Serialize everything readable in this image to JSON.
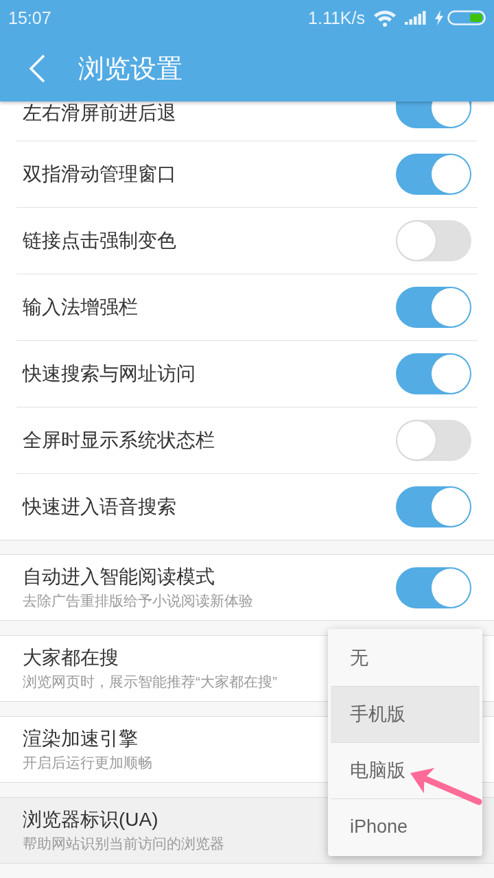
{
  "status_bar": {
    "time": "15:07",
    "net_speed": "1.11K/s"
  },
  "app_bar": {
    "title": "浏览设置"
  },
  "toggle_group": [
    {
      "label": "左右滑屏前进后退",
      "on": true
    },
    {
      "label": "双指滑动管理窗口",
      "on": true
    },
    {
      "label": "链接点击强制变色",
      "on": false
    },
    {
      "label": "输入法增强栏",
      "on": true
    },
    {
      "label": "快速搜索与网址访问",
      "on": true
    },
    {
      "label": "全屏时显示系统状态栏",
      "on": false
    },
    {
      "label": "快速进入语音搜索",
      "on": true
    }
  ],
  "cards": [
    {
      "kind": "toggle",
      "title": "自动进入智能阅读模式",
      "subtitle": "去除广告重排版给予小说阅读新体验",
      "on": true,
      "pressed": false
    },
    {
      "kind": "plain",
      "title": "大家都在搜",
      "subtitle": "浏览网页时，展示智能推荐“大家都在搜”",
      "pressed": false
    },
    {
      "kind": "plain",
      "title": "渲染加速引擎",
      "subtitle": "开启后运行更加顺畅",
      "pressed": false
    },
    {
      "kind": "plain",
      "title": "浏览器标识(UA)",
      "subtitle": "帮助网站识别当前访问的浏览器",
      "pressed": true
    }
  ],
  "popup_menu": {
    "items": [
      {
        "label": "无",
        "selected": false
      },
      {
        "label": "手机版",
        "selected": true
      },
      {
        "label": "电脑版",
        "selected": false
      },
      {
        "label": "iPhone",
        "selected": false
      }
    ]
  }
}
